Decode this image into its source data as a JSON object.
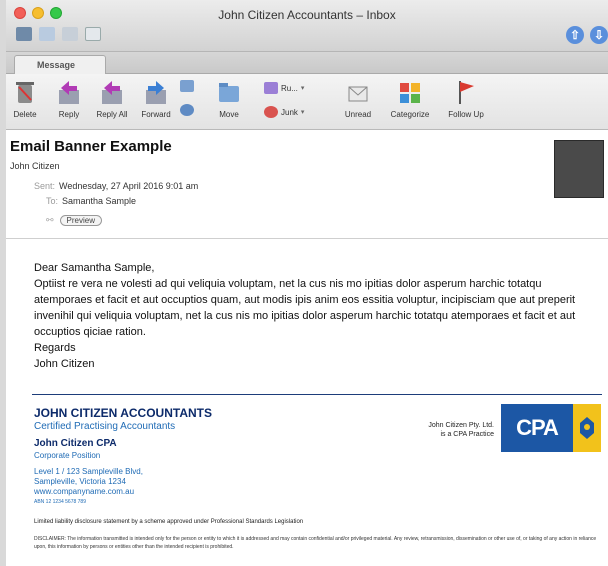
{
  "window": {
    "title": "John Citizen Accountants – Inbox"
  },
  "ribbon": {
    "tab": "Message",
    "buttons": {
      "delete": "Delete",
      "reply": "Reply",
      "reply_all": "Reply All",
      "forward": "Forward",
      "move": "Move",
      "rules": "Ru...",
      "junk": "Junk",
      "unread": "Unread",
      "categorize": "Categorize",
      "follow_up": "Follow Up"
    }
  },
  "header": {
    "subject": "Email Banner Example",
    "from": "John Citizen",
    "sent_label": "Sent:",
    "sent": "Wednesday, 27 April 2016 9:01 am",
    "to_label": "To:",
    "to": "Samantha Sample",
    "preview": "Preview"
  },
  "body": {
    "greeting": "Dear Samantha Sample,",
    "paragraph": "Optiist re vera ne volesti ad qui veliquia voluptam, net la cus nis mo ipitias dolor asperum harchic totatqu atemporaes et facit et aut occuptios quam, aut modis ipis anim eos essitia voluptur, incipisciam que aut preperit invenihil qui veliquia voluptam, net la cus nis mo ipitias dolor asperum harchic totatqu atemporaes et facit et aut occuptios qiciae ration.",
    "regards": "Regards",
    "sign": "John Citizen"
  },
  "signature": {
    "firm": "JOHN CITIZEN ACCOUNTANTS",
    "firm_sub": "Certified Practising Accountants",
    "person": "John Citizen CPA",
    "position": "Corporate Position",
    "addr1": "Level 1 / 123 Sampleville Blvd,",
    "addr2": "Sampleville, Victoria 1234",
    "web": "www.companyname.com.au",
    "abn": "ABN 12 1234 5678 789",
    "pty1": "John Citizen Pty. Ltd.",
    "pty2": "is a CPA Practice",
    "logo": "CPA",
    "liability": "Limited liability disclosure statement by a scheme approved under Professional Standards Legislation",
    "disclaimer": "DISCLAIMER: The information transmitted is intended only for the person or entity to which it is addressed and may contain confidential and/or privileged material. Any review, retransmission, dissemination or other use of, or taking of any action in reliance upon, this information by persons or entities other than the intended recipient is prohibited."
  },
  "colors": {
    "navy": "#0c2a6a",
    "blue": "#1f6bb5",
    "cpa_blue": "#1c57a5",
    "cpa_gold": "#f2c21b"
  }
}
